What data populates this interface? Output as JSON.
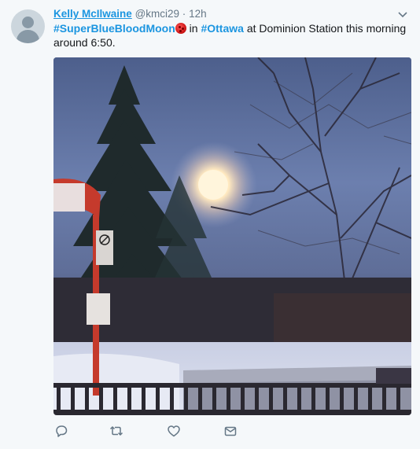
{
  "tweet": {
    "author_name": "Kelly McIlwaine",
    "handle": "@kmci29",
    "separator": "·",
    "time": "12h",
    "text_parts": {
      "hashtag1": "#SuperBlueBloodMoon",
      "in": " in ",
      "hashtag2": "#Ottawa",
      "rest": " at Dominion Station this morning around 6:50."
    }
  },
  "icons": {
    "more": "chevron-down-icon",
    "emoji": "red-full-moon-emoji",
    "reply": "reply-icon",
    "retweet": "retweet-icon",
    "like": "heart-icon",
    "message": "envelope-icon"
  },
  "colors": {
    "link": "#1b95e0",
    "muted": "#657786",
    "background": "#f5f8fa"
  }
}
